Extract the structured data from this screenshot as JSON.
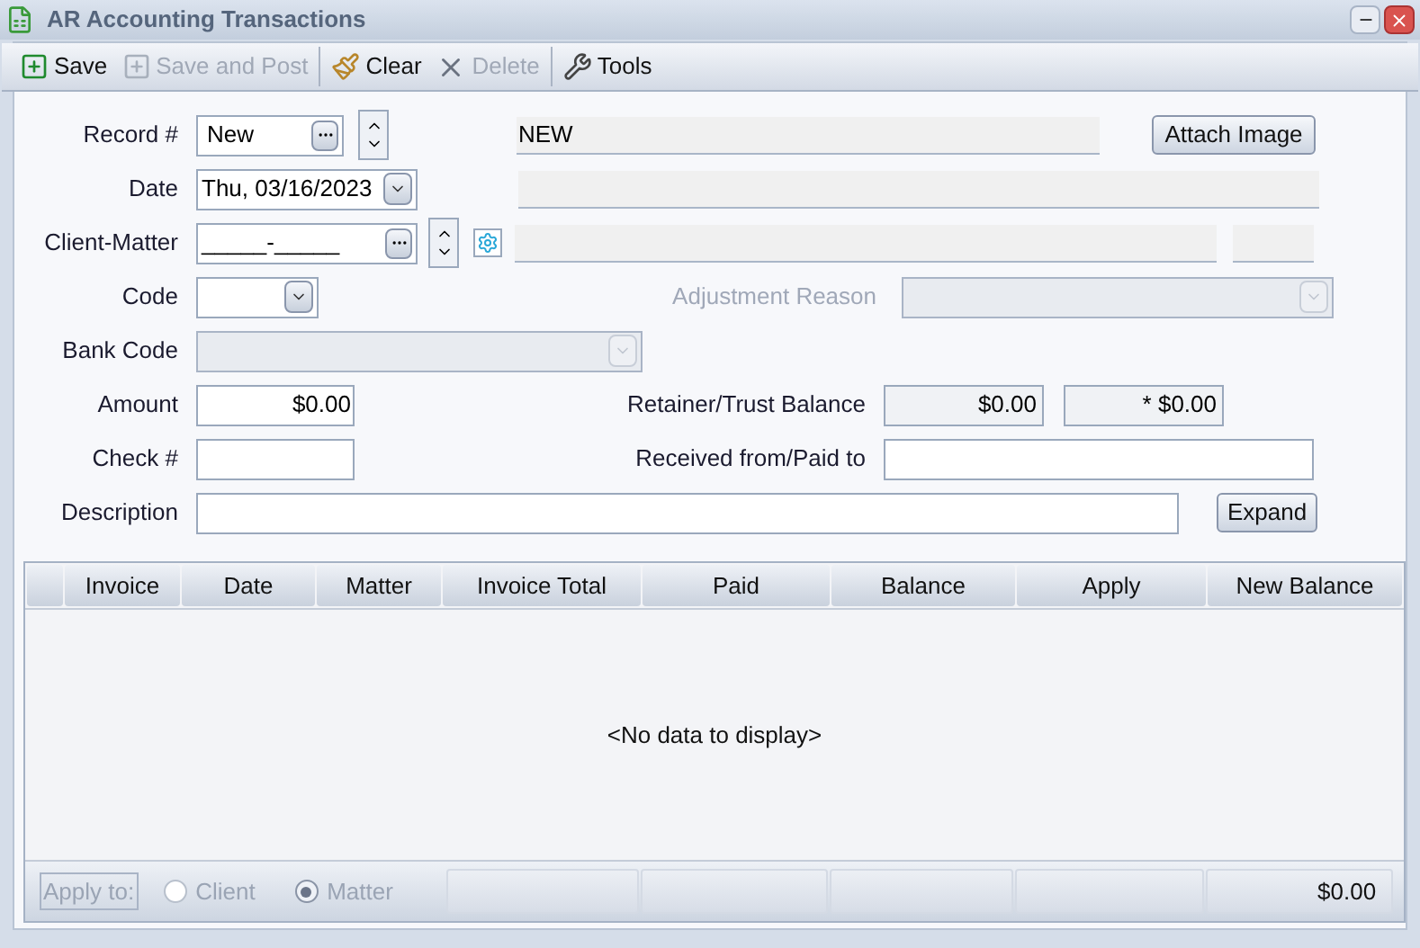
{
  "window": {
    "title": "AR Accounting Transactions"
  },
  "toolbar": [
    {
      "kind": "save",
      "label": "Save",
      "disabled": false
    },
    {
      "kind": "save_post",
      "label": "Save and Post",
      "disabled": true
    },
    {
      "kind": "clear",
      "label": "Clear",
      "disabled": false
    },
    {
      "kind": "delete",
      "label": "Delete",
      "disabled": true
    },
    {
      "kind": "tools",
      "label": "Tools",
      "disabled": false
    }
  ],
  "form": {
    "record": {
      "label": "Record #",
      "value": "New",
      "display": "NEW"
    },
    "attach_button": "Attach Image",
    "date": {
      "label": "Date",
      "value": "Thu, 03/16/2023"
    },
    "client_matter": {
      "label": "Client-Matter",
      "value": "_____-_____"
    },
    "code": {
      "label": "Code"
    },
    "adjustment_reason": {
      "label": "Adjustment Reason",
      "disabled": true
    },
    "bank_code": {
      "label": "Bank Code",
      "disabled": true
    },
    "amount": {
      "label": "Amount",
      "value": "$0.00"
    },
    "retainer_trust_balance": {
      "label": "Retainer/Trust Balance",
      "values": [
        "$0.00",
        "* $0.00"
      ]
    },
    "check": {
      "label": "Check #"
    },
    "received_from": {
      "label": "Received from/Paid to"
    },
    "description": {
      "label": "Description"
    },
    "expand_button": "Expand"
  },
  "grid": {
    "columns": [
      "Invoice",
      "Date",
      "Matter",
      "Invoice Total",
      "Paid",
      "Balance",
      "Apply",
      "New Balance"
    ],
    "empty_text": "<No data to display>",
    "footer": {
      "apply_to": {
        "label": "Apply to:",
        "disabled": true,
        "options": [
          {
            "label": "Client",
            "selected": false
          },
          {
            "label": "Matter",
            "selected": true
          }
        ]
      },
      "new_balance_total": "$0.00"
    }
  }
}
